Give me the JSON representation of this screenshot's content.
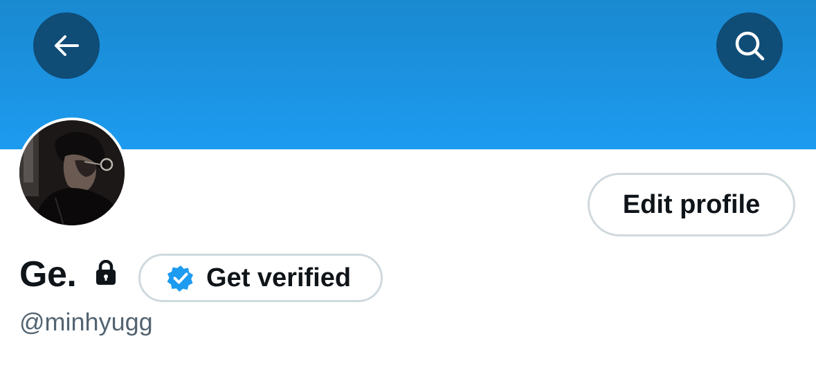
{
  "header": {
    "back_icon": "arrow-left-icon",
    "search_icon": "search-icon",
    "banner_color": "#1D9BF0"
  },
  "profile": {
    "display_name": "Ge.",
    "handle": "@minhyugg",
    "lock_icon": "lock-icon",
    "avatar_icon": "avatar"
  },
  "actions": {
    "edit_profile_label": "Edit profile",
    "get_verified_label": "Get verified",
    "verified_icon": "verified-badge-icon"
  },
  "colors": {
    "accent": "#1D9BF0",
    "text_primary": "#0F1419",
    "text_secondary": "#536471",
    "button_border": "#CFD9DE",
    "overlay_button": "#0F4C76"
  }
}
